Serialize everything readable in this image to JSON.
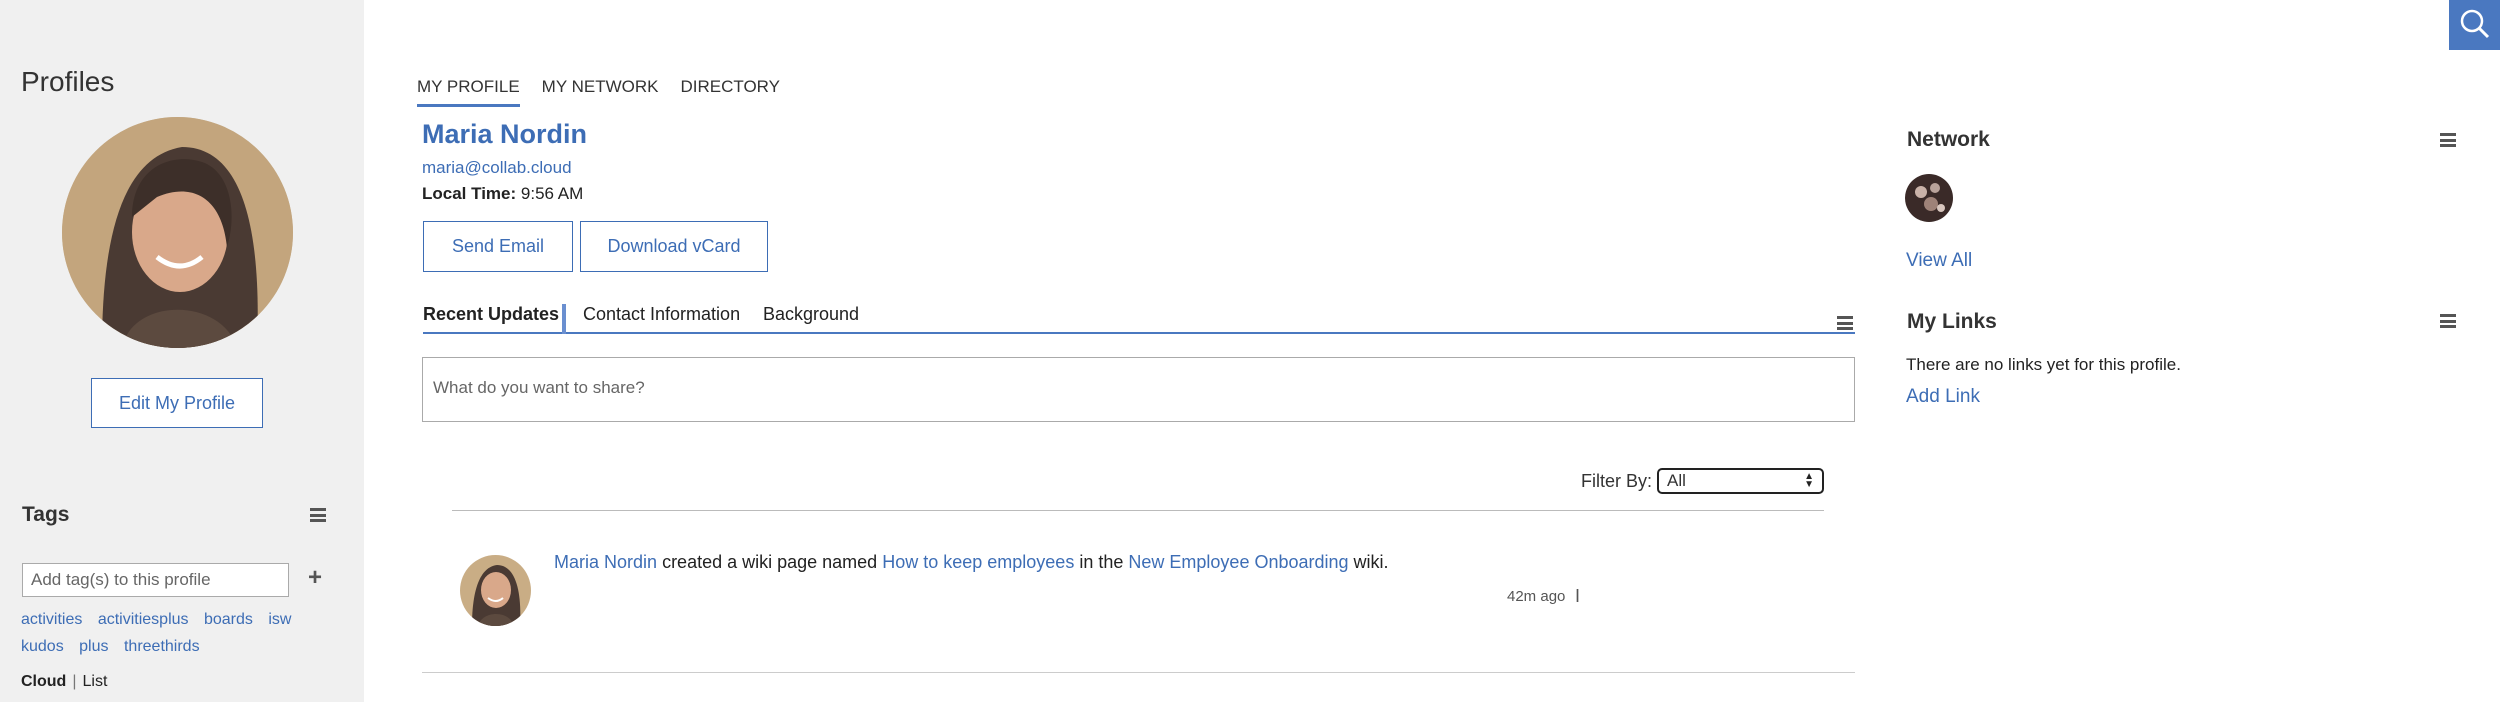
{
  "sidebar": {
    "title": "Profiles",
    "edit_profile_label": "Edit My Profile",
    "tags_title": "Tags",
    "tag_input_placeholder": "Add tag(s) to this profile",
    "add_tag_symbol": "+",
    "tags": [
      "activities",
      "activitiesplus",
      "boards",
      "isw",
      "kudos",
      "plus",
      "threethirds"
    ],
    "view_modes": {
      "cloud": "Cloud",
      "list": "List"
    }
  },
  "nav": {
    "tabs": [
      {
        "label": "MY PROFILE",
        "active": true
      },
      {
        "label": "MY NETWORK",
        "active": false
      },
      {
        "label": "DIRECTORY",
        "active": false
      }
    ]
  },
  "profile": {
    "name": "Maria Nordin",
    "email": "maria@collab.cloud",
    "local_time_label": "Local Time:",
    "local_time_value": "9:56 AM",
    "send_email_label": "Send Email",
    "vcard_label": "Download vCard"
  },
  "profile_tabs": {
    "recent": "Recent Updates",
    "contact": "Contact Information",
    "background": "Background"
  },
  "share": {
    "placeholder": "What do you want to share?"
  },
  "filter": {
    "label": "Filter By:",
    "selected": "All"
  },
  "feed": [
    {
      "actor": "Maria Nordin",
      "text1": "created a wiki page named",
      "page": "How to keep employees",
      "text2": "in the",
      "wiki": "New Employee Onboarding",
      "text3": "wiki.",
      "time": "42m ago"
    }
  ],
  "right": {
    "network_title": "Network",
    "view_all": "View All",
    "links_title": "My Links",
    "no_links": "There are no links yet for this profile.",
    "add_link": "Add Link"
  },
  "colors": {
    "accent": "#3d6db5",
    "sidebar_bg": "#f0f0f0",
    "search_bg": "#4a78c0"
  },
  "icons": [
    "search-icon",
    "menu-icon",
    "plus-icon",
    "cursor-icon"
  ]
}
